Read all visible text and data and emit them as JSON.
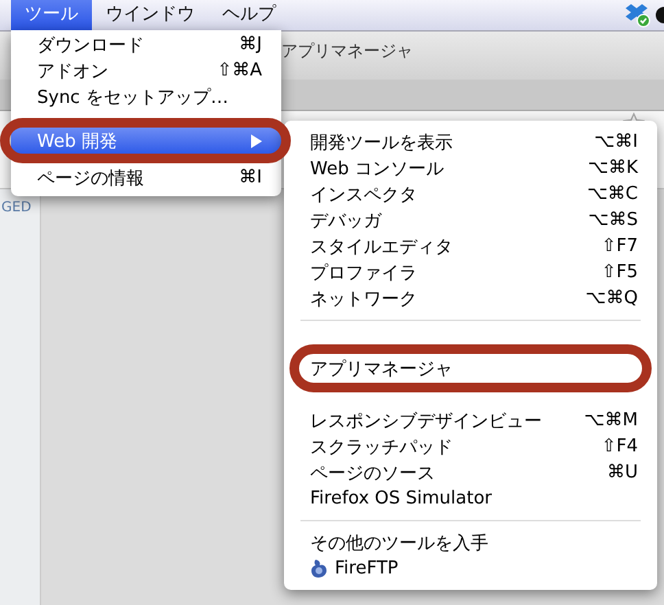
{
  "menu_bar": [
    {
      "label": "ツール",
      "selected": true
    },
    {
      "label": "ウインドウ",
      "selected": false
    },
    {
      "label": "ヘルプ",
      "selected": false
    }
  ],
  "window": {
    "title": "アプリマネージャ",
    "sidebar_label": "GED"
  },
  "tools_menu": [
    {
      "label": "ダウンロード",
      "shortcut": "⌘J",
      "selected": false
    },
    {
      "label": "アドオン",
      "shortcut": "⇧⌘A",
      "selected": false
    },
    {
      "label": "Sync をセットアップ…",
      "selected": false
    },
    {
      "label": "Web 開発",
      "submenu": true,
      "selected": true
    },
    {
      "label": "ページの情報",
      "shortcut": "⌘I",
      "selected": false
    }
  ],
  "web_dev_menu": [
    {
      "label": "開発ツールを表示",
      "shortcut": "⌥⌘I"
    },
    {
      "label": "Web コンソール",
      "shortcut": "⌥⌘K"
    },
    {
      "label": "インスペクタ",
      "shortcut": "⌥⌘C"
    },
    {
      "label": "デバッガ",
      "shortcut": "⌥⌘S"
    },
    {
      "label": "スタイルエディタ",
      "shortcut": "⇧F7"
    },
    {
      "label": "プロファイラ",
      "shortcut": "⇧F5"
    },
    {
      "label": "ネットワーク",
      "shortcut": "⌥⌘Q"
    },
    {
      "kind": "separator"
    },
    {
      "kind": "covered"
    },
    {
      "label": "アプリマネージャ"
    },
    {
      "kind": "covered"
    },
    {
      "label": "レスポンシブデザインビュー",
      "shortcut": "⌥⌘M"
    },
    {
      "label": "スクラッチパッド",
      "shortcut": "⇧F4"
    },
    {
      "label": "ページのソース",
      "shortcut": "⌘U"
    },
    {
      "label": "Firefox OS Simulator"
    },
    {
      "kind": "separator"
    },
    {
      "label": "その他のツールを入手"
    },
    {
      "label": "FireFTP",
      "kind": "addon"
    }
  ]
}
